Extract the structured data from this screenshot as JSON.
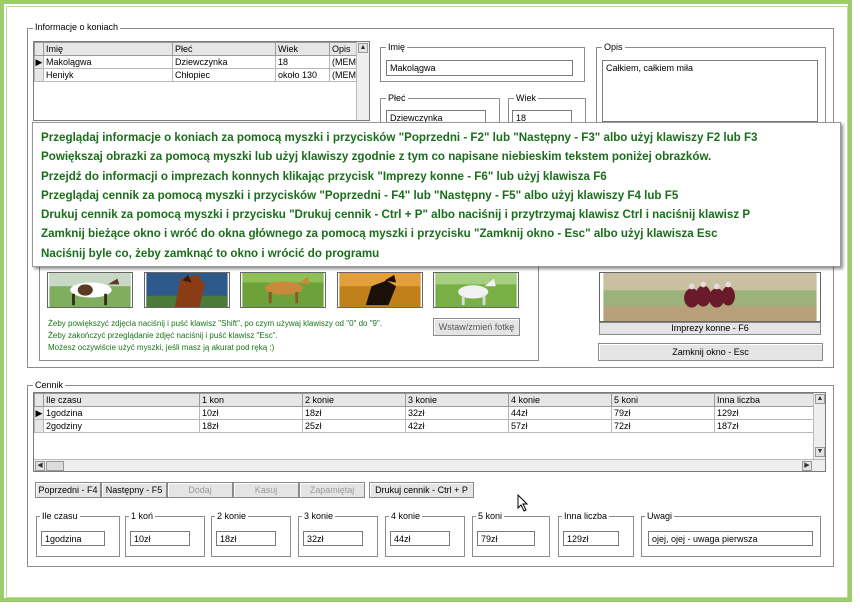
{
  "horses": {
    "group_title": "Informacje o koniach",
    "columns": [
      "Imię",
      "Płeć",
      "Wiek",
      "Opis"
    ],
    "rows": [
      [
        "Makolągwa",
        "Dziewczynka",
        "18",
        "(MEM"
      ],
      [
        "Heniyk",
        "Chłopiec",
        "około 130",
        "(MEM"
      ]
    ]
  },
  "detail": {
    "name_label": "Imię",
    "name_value": "Makolągwa",
    "sex_label": "Płeć",
    "sex_value": "Dziewczynka",
    "age_label": "Wiek",
    "age_value": "18",
    "desc_label": "Opis",
    "desc_value": "Całkiem, całkiem miła"
  },
  "help_overlay": {
    "lines": [
      "Przeglądaj informacje o koniach za pomocą myszki i przycisków \"Poprzedni - F2\" lub \"Następny - F3\" albo użyj klawiszy F2 lub F3",
      "Powiększaj obrazki za pomocą myszki lub użyj klawiszy zgodnie z tym co napisane niebieskim tekstem poniżej obrazków.",
      "Przejdź do informacji o imprezach konnych klikając przycisk \"Imprezy konne - F6\" lub użyj klawisza F6",
      "Przeglądaj cennik za pomocą myszki i przycisków \"Poprzedni - F4\" lub \"Następny - F5\" albo użyj klawiszy F4 lub F5",
      "Drukuj cennik za pomocą myszki i przycisku \"Drukuj cennik - Ctrl + P\" albo naciśnij i przytrzymaj klawisz Ctrl i naciśnij klawisz P",
      "Zamknij bieżące okno i wróć do okna głównego za pomocą myszki i przycisku \"Zamknij okno - Esc\" albo użyj klawisza Esc",
      "Naciśnij byle co, żeby zamknąć to okno i wrócić do programu"
    ]
  },
  "photos": {
    "hint_lines": [
      "Żeby powiększyć zdjęcia naciśnij i puść klawisz \"Shift\", po czym  używaj klawiszy od \"0\" do \"9\".",
      "Żeby zakończyć przeglądanie zdjęć naciśnij i puść klawisz \"Esc\".",
      "Możesz oczywiście użyć myszki, jeśli masz ją akurat pod ręką :)"
    ],
    "set_photo_button": "Wstaw/zmień fotkę"
  },
  "events": {
    "caption": "Imprezy konne - F6",
    "close_button": "Zamknij okno - Esc"
  },
  "prices": {
    "group_title": "Cennik",
    "columns": [
      "Ile czasu",
      "1 kon",
      "2 konie",
      "3 konie",
      "4 konie",
      "5 koni",
      "Inna liczba"
    ],
    "rows": [
      [
        "1godzina",
        "10zł",
        "18zł",
        "32zł",
        "44zł",
        "79zł",
        "129zł"
      ],
      [
        "2godziny",
        "18zł",
        "25zł",
        "42zł",
        "57zł",
        "72zł",
        "187zł"
      ]
    ],
    "buttons": {
      "prev": "Poprzedni - F4",
      "next": "Następny - F5",
      "add": "Dodaj",
      "cancel": "Kasuj",
      "save": "Zapamiętaj",
      "print": "Drukuj cennik - Ctrl + P"
    },
    "fields": [
      {
        "label": "Ile czasu",
        "value": "1godzina"
      },
      {
        "label": "1 koń",
        "value": "10zł"
      },
      {
        "label": "2 konie",
        "value": "18zł"
      },
      {
        "label": "3 konie",
        "value": "32zł"
      },
      {
        "label": "4 konie",
        "value": "44zł"
      },
      {
        "label": "5 koni",
        "value": "79zł"
      },
      {
        "label": "Inna liczba",
        "value": "129zł"
      },
      {
        "label": "Uwagi",
        "value": "ojej, ojej - uwaga pierwsza"
      }
    ]
  },
  "colors": {
    "frame": "#9ccd6a",
    "help_text": "#1a6e1a",
    "hint_text": "#197519"
  }
}
